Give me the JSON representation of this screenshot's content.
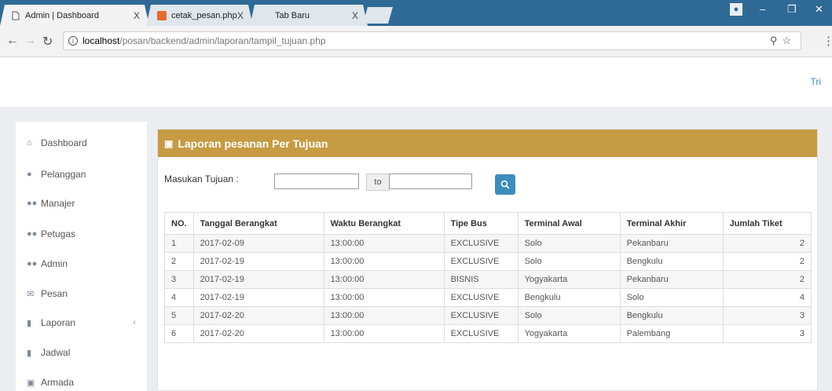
{
  "browser": {
    "tabs": [
      {
        "title": "Admin | Dashboard",
        "close": "X"
      },
      {
        "title": "cetak_pesan.php",
        "close": "X"
      },
      {
        "title": "Tab Baru",
        "close": "X"
      }
    ],
    "url_host": "localhost",
    "url_path": "/posan/backend/admin/laporan/tampil_tujuan.php",
    "accent": "#2f6a96"
  },
  "header": {
    "user": "Tri"
  },
  "sidebar": {
    "items": [
      {
        "label": "Dashboard",
        "icon": "home-icon"
      },
      {
        "label": "Pelanggan",
        "icon": "user-icon"
      },
      {
        "label": "Manajer",
        "icon": "users-icon"
      },
      {
        "label": "Petugas",
        "icon": "users-icon"
      },
      {
        "label": "Admin",
        "icon": "users-icon"
      },
      {
        "label": "Pesan",
        "icon": "envelope-icon"
      },
      {
        "label": "Laporan",
        "icon": "book-icon"
      },
      {
        "label": "Jadwal",
        "icon": "book-icon"
      },
      {
        "label": "Armada",
        "icon": "car-icon"
      }
    ]
  },
  "panel": {
    "title": "Laporan pesanan Per Tujuan",
    "header_color": "#c79b43",
    "filter_label": "Masukan Tujuan :",
    "to_label": "to",
    "input_from_value": "",
    "input_to_value": ""
  },
  "table": {
    "headers": [
      "NO.",
      "Tanggal Berangkat",
      "Waktu Berangkat",
      "Tipe Bus",
      "Terminal Awal",
      "Terminal Akhir",
      "Jumlah Tiket"
    ],
    "rows": [
      [
        "1",
        "2017-02-09",
        "13:00:00",
        "EXCLUSIVE",
        "Solo",
        "Pekanbaru",
        "2"
      ],
      [
        "2",
        "2017-02-19",
        "13:00:00",
        "EXCLUSIVE",
        "Solo",
        "Bengkulu",
        "2"
      ],
      [
        "3",
        "2017-02-19",
        "13:00:00",
        "BISNIS",
        "Yogyakarta",
        "Pekanbaru",
        "2"
      ],
      [
        "4",
        "2017-02-19",
        "13:00:00",
        "EXCLUSIVE",
        "Bengkulu",
        "Solo",
        "4"
      ],
      [
        "5",
        "2017-02-20",
        "13:00:00",
        "EXCLUSIVE",
        "Solo",
        "Bengkulu",
        "3"
      ],
      [
        "6",
        "2017-02-20",
        "13:00:00",
        "EXCLUSIVE",
        "Yogyakarta",
        "Palembang",
        "3"
      ]
    ]
  }
}
